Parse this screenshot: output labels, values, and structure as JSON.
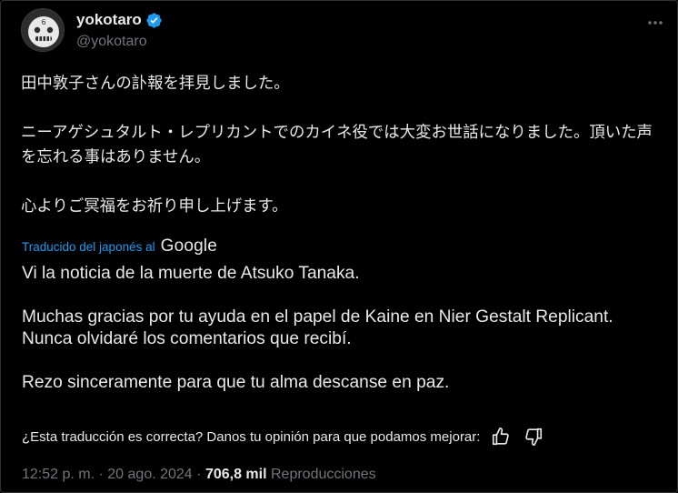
{
  "author": {
    "display_name": "yokotaro",
    "handle": "@yokotaro",
    "verified": true
  },
  "original_text": {
    "p1": "田中敦子さんの訃報を拝見しました。",
    "p2": "ニーアゲシュタルト・レプリカントでのカイネ役では大変お世話になりました。頂いた声を忘れる事はありません。",
    "p3": "心よりご冥福をお祈り申し上げます。"
  },
  "translation_label": "Traducido del japonés al",
  "translation_provider": "Google",
  "translation": {
    "p1": "Vi la noticia de la muerte de Atsuko Tanaka.",
    "p2": "Muchas gracias por tu ayuda en el papel de Kaine en Nier Gestalt Replicant. Nunca olvidaré los comentarios que recibí.",
    "p3": "Rezo sinceramente para que tu alma descanse en paz."
  },
  "feedback_prompt": "¿Esta traducción es correcta? Danos tu opinión para que podamos mejorar:",
  "meta": {
    "time": "12:52 p. m.",
    "separator": "·",
    "date": "20 ago. 2024",
    "views_count": "706,8 mil",
    "views_label": "Reproducciones"
  },
  "colors": {
    "background": "#000000",
    "text": "#e7e9ea",
    "muted": "#71767b",
    "accent": "#1d9bf0"
  },
  "icons": {
    "more": "more-horizontal-icon",
    "verified": "verified-badge-icon",
    "thumbs_up": "thumbs-up-icon",
    "thumbs_down": "thumbs-down-icon"
  }
}
